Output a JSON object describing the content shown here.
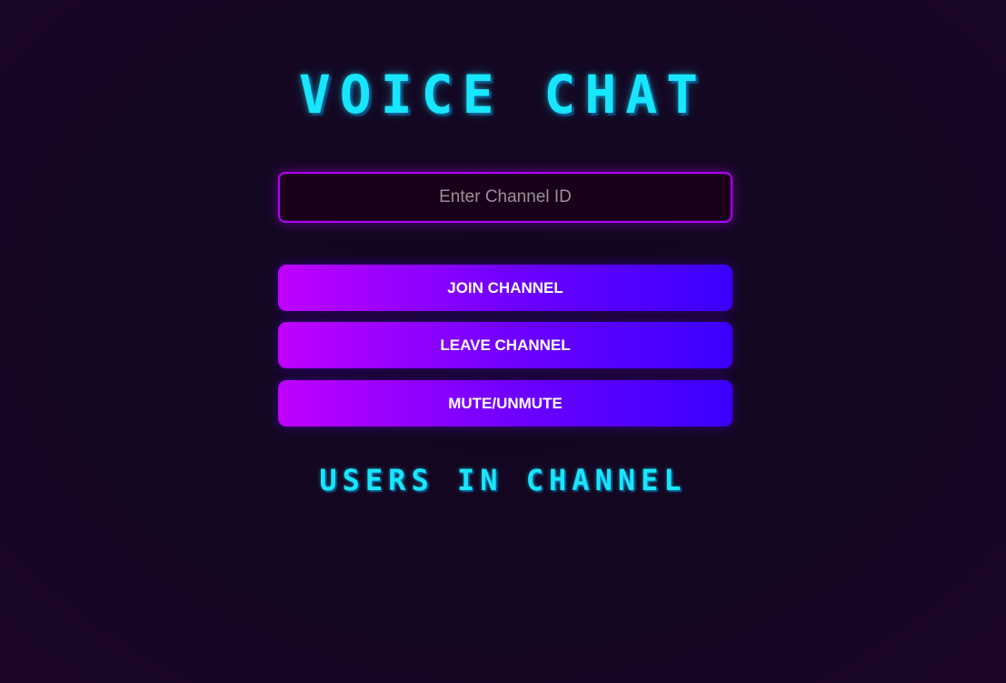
{
  "app": {
    "title": "VOICE CHAT",
    "channel_input": {
      "value": "",
      "placeholder": "Enter Channel ID"
    },
    "buttons": {
      "join": "JOIN CHANNEL",
      "leave": "LEAVE CHANNEL",
      "mute": "MUTE/UNMUTE"
    },
    "users_heading": "USERS IN CHANNEL",
    "users": []
  },
  "colors": {
    "background": "#150722",
    "title_cyan": "#18e6ff",
    "input_border": "#b300ff",
    "button_gradient_start": "#c000ff",
    "button_gradient_end": "#3a00ff"
  }
}
